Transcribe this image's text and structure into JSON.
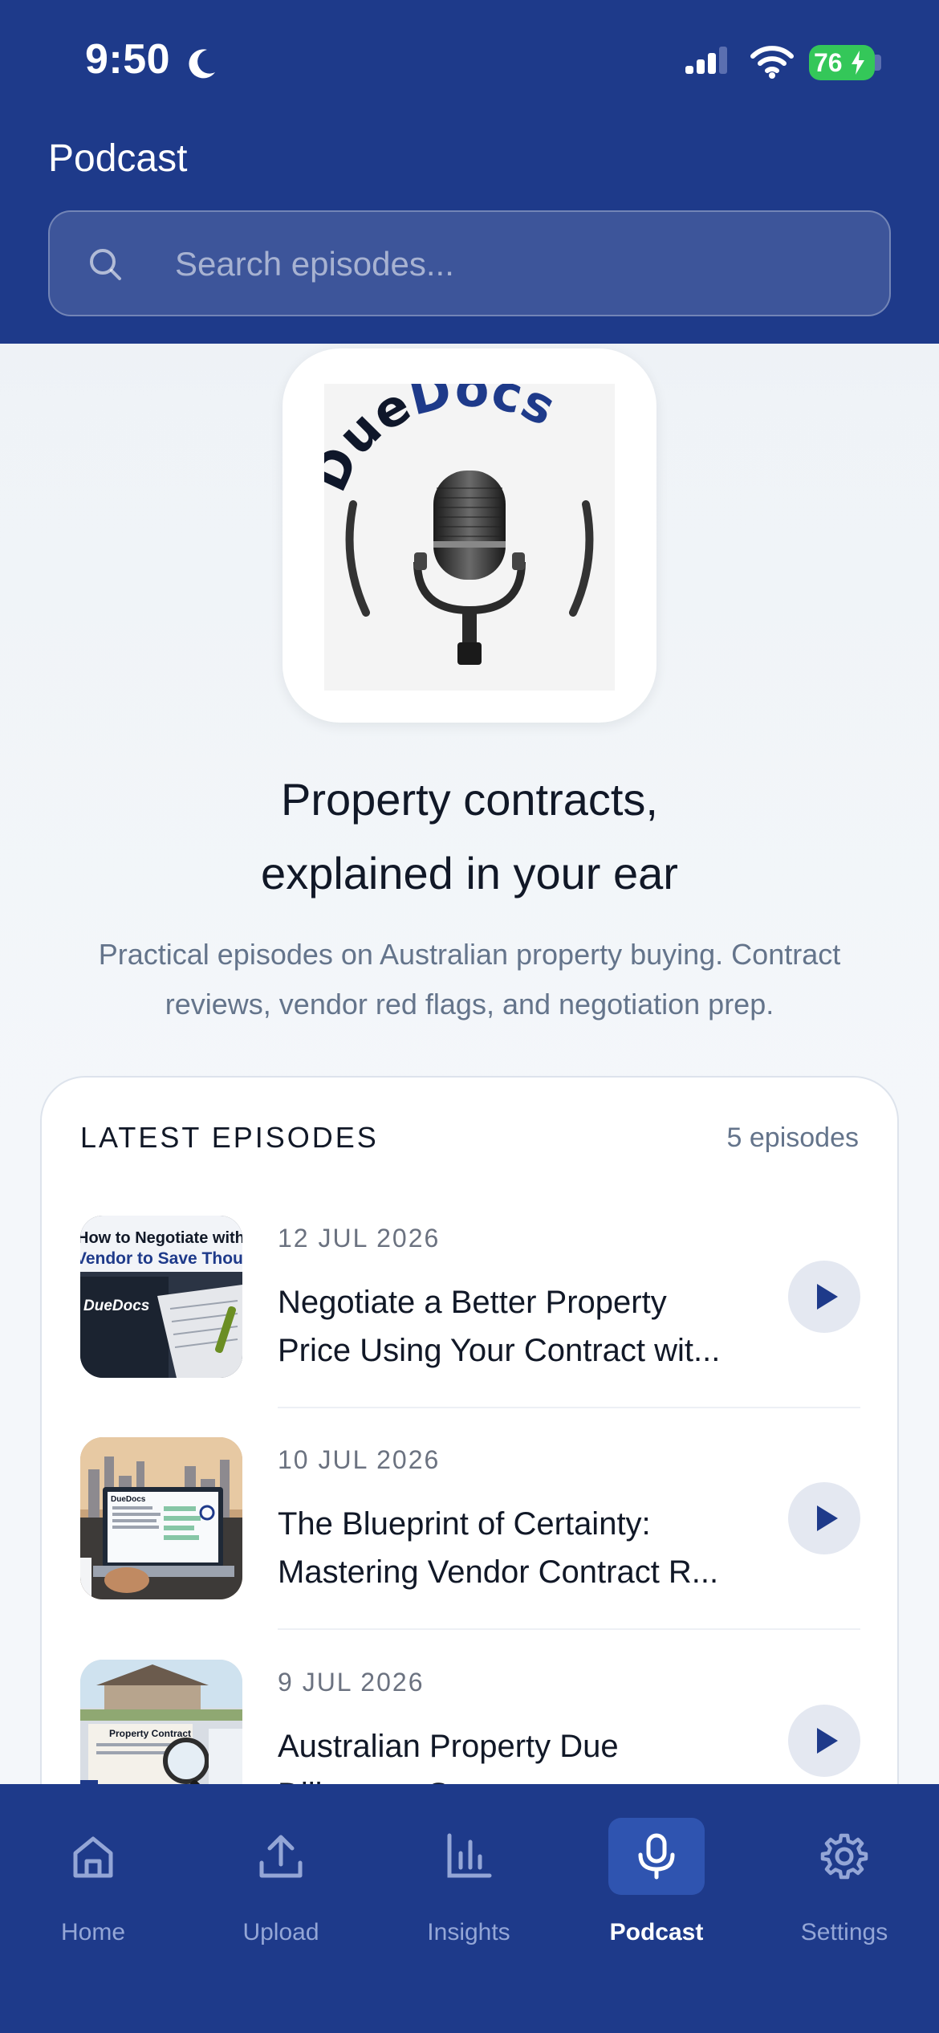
{
  "status_bar": {
    "time": "9:50",
    "battery_level": "76"
  },
  "header": {
    "title": "Podcast",
    "search_placeholder": "Search episodes..."
  },
  "logo": {
    "text_part1": "Due",
    "text_part2": "Docs"
  },
  "hero": {
    "title_line1": "Property contracts,",
    "title_line2": "explained in your ear",
    "description": "Practical episodes on Australian property buying. Contract reviews, vendor red flags, and negotiation prep."
  },
  "episodes": {
    "heading": "LATEST EPISODES",
    "count": "5 episodes",
    "items": [
      {
        "date": "12 JUL 2026",
        "title": "Negotiate a Better Property Price Using Your Contract wit...",
        "thumb_text1": "How to Negotiate with",
        "thumb_text2": "Vendor to Save Thousands",
        "thumb_brand": "DueDocs"
      },
      {
        "date": "10 JUL 2026",
        "title": "The Blueprint of Certainty: Mastering Vendor Contract R...",
        "thumb_brand": "DueDocs"
      },
      {
        "date": "9 JUL 2026",
        "title": "Australian Property Due Diligence: S...",
        "thumb_text1": "Property Contract"
      }
    ]
  },
  "bottom_nav": {
    "items": [
      {
        "label": "Home",
        "icon": "home-icon"
      },
      {
        "label": "Upload",
        "icon": "upload-icon"
      },
      {
        "label": "Insights",
        "icon": "bar-chart-icon"
      },
      {
        "label": "Podcast",
        "icon": "microphone-icon",
        "active": true
      },
      {
        "label": "Settings",
        "icon": "gear-icon"
      }
    ]
  },
  "colors": {
    "primary": "#1e3a8a",
    "active_tab": "#2f54b0",
    "battery": "#34c759"
  }
}
